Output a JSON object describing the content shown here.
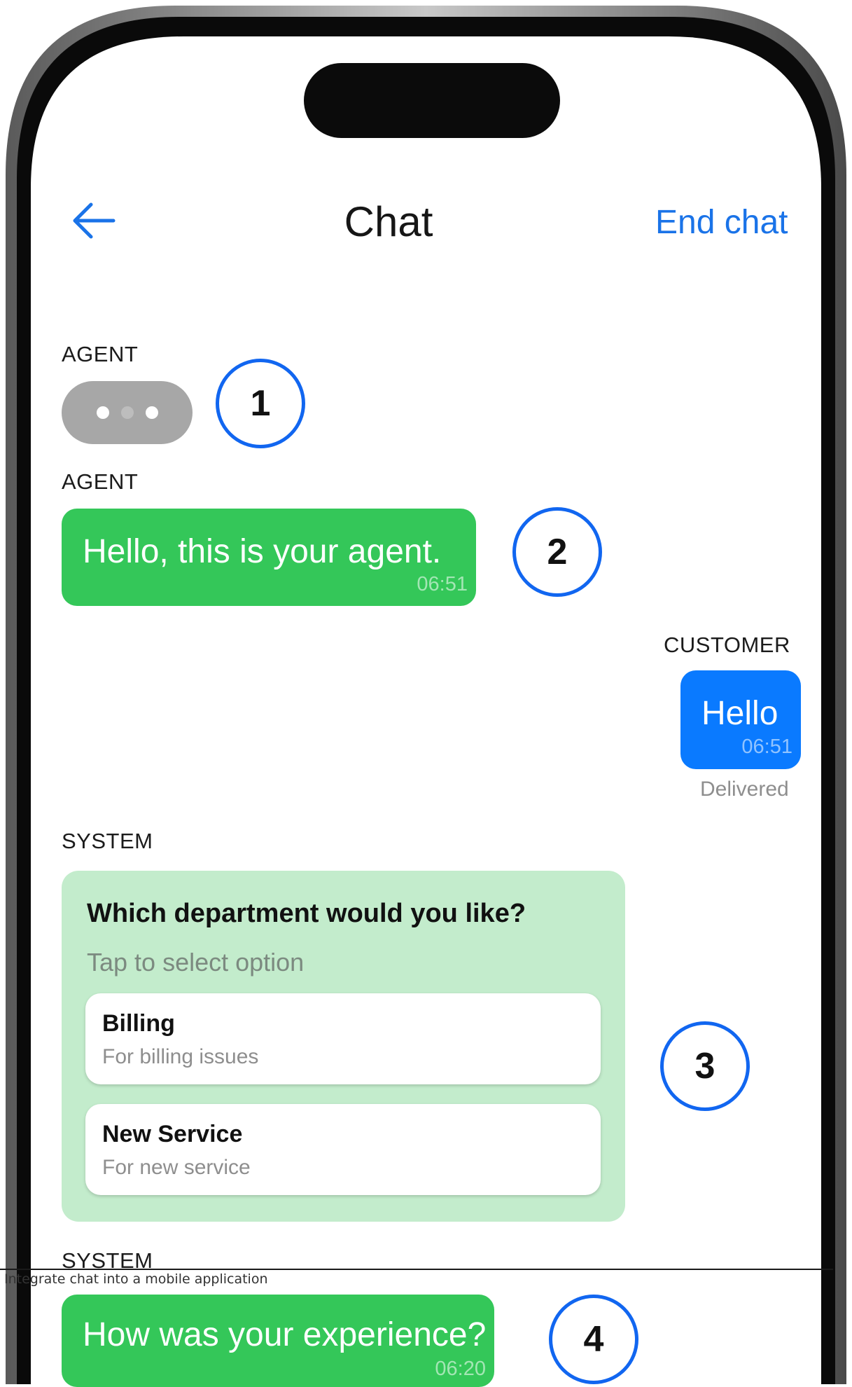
{
  "header": {
    "title": "Chat",
    "end_chat_label": "End chat"
  },
  "messages": {
    "typing": {
      "sender": "AGENT"
    },
    "agent_greeting": {
      "sender": "AGENT",
      "text": "Hello, this is your agent.",
      "time": "06:51"
    },
    "customer_reply": {
      "sender": "CUSTOMER",
      "text": "Hello",
      "time": "06:51",
      "status": "Delivered"
    },
    "system_options": {
      "sender": "SYSTEM",
      "title": "Which department would you like?",
      "subtitle": "Tap to select option",
      "options": [
        {
          "title": "Billing",
          "description": "For billing issues"
        },
        {
          "title": "New Service",
          "description": "For new service"
        }
      ]
    },
    "system_survey": {
      "sender": "SYSTEM",
      "text": "How was your experience?",
      "time": "06:20"
    }
  },
  "callouts": [
    "1",
    "2",
    "3",
    "4"
  ],
  "caption": "Integrate chat into a mobile application",
  "colors": {
    "agent_bubble": "#34c759",
    "customer_bubble": "#0a7aff",
    "options_card": "#c3eccc",
    "link": "#1a73e8",
    "callout_ring": "#1166f0"
  }
}
